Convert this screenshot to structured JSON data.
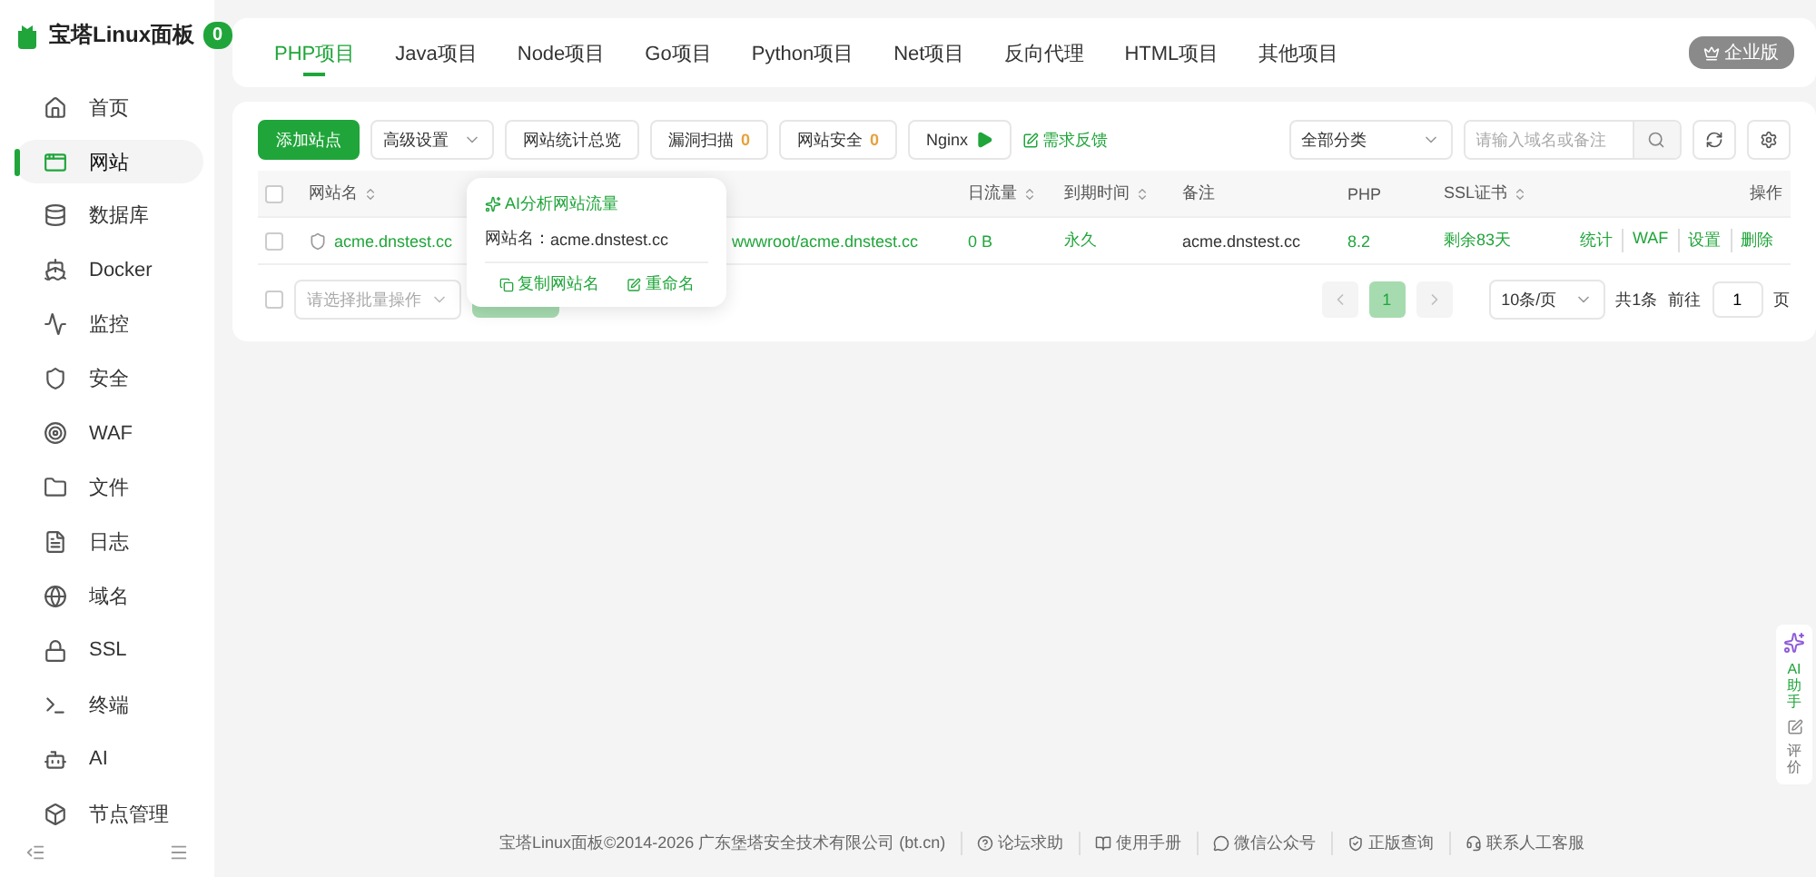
{
  "sidebar": {
    "brand": "宝塔Linux面板",
    "badge": "0",
    "items": [
      {
        "label": "首页",
        "selected": false
      },
      {
        "label": "网站",
        "selected": true
      },
      {
        "label": "数据库",
        "selected": false
      },
      {
        "label": "Docker",
        "selected": false
      },
      {
        "label": "监控",
        "selected": false
      },
      {
        "label": "安全",
        "selected": false
      },
      {
        "label": "WAF",
        "selected": false
      },
      {
        "label": "文件",
        "selected": false
      },
      {
        "label": "日志",
        "selected": false
      },
      {
        "label": "域名",
        "selected": false
      },
      {
        "label": "SSL",
        "selected": false
      },
      {
        "label": "终端",
        "selected": false
      },
      {
        "label": "AI",
        "selected": false
      },
      {
        "label": "节点管理",
        "selected": false
      }
    ]
  },
  "tabs": [
    {
      "label": "PHP项目",
      "selected": true
    },
    {
      "label": "Java项目",
      "selected": false
    },
    {
      "label": "Node项目",
      "selected": false
    },
    {
      "label": "Go项目",
      "selected": false
    },
    {
      "label": "Python项目",
      "selected": false
    },
    {
      "label": "Net项目",
      "selected": false
    },
    {
      "label": "反向代理",
      "selected": false
    },
    {
      "label": "HTML项目",
      "selected": false
    },
    {
      "label": "其他项目",
      "selected": false
    }
  ],
  "edition": "企业版",
  "toolbar": {
    "add": "添加站点",
    "advanced": "高级设置",
    "stats": "网站统计总览",
    "scan": {
      "label": "漏洞扫描",
      "count": "0"
    },
    "security": {
      "label": "网站安全",
      "count": "0"
    },
    "server": "Nginx",
    "feedback": "需求反馈",
    "category": "全部分类",
    "search": {
      "placeholder": "请输入域名或备注"
    }
  },
  "table": {
    "columns": [
      {
        "label": "网站名",
        "sort": true
      },
      {
        "label": "日流量",
        "sort": true
      },
      {
        "label": "到期时间",
        "sort": true
      },
      {
        "label": "备注",
        "sort": false
      },
      {
        "label": "PHP",
        "sort": false
      },
      {
        "label": "SSL证书",
        "sort": true
      },
      {
        "label": "操作",
        "sort": false
      }
    ],
    "select_all_checked": false,
    "rows": [
      {
        "checked": false,
        "name": "acme.dnstest.cc",
        "path": "wwwroot/acme.dnstest.cc",
        "traffic": "0 B",
        "expiry": "永久",
        "note": "acme.dnstest.cc",
        "php": "8.2",
        "ssl": "剩余83天",
        "actions": [
          "统计",
          "WAF",
          "设置",
          "删除"
        ]
      }
    ]
  },
  "batch": {
    "checked": false,
    "placeholder": "请选择批量操作"
  },
  "pagination": {
    "pages": [
      {
        "label": "1",
        "selected": true
      }
    ],
    "page_size": "10条/页",
    "total": "共1条",
    "goto": "前往",
    "goto_value": "1",
    "page_unit": "页"
  },
  "popover": {
    "ai": "AI分析网站流量",
    "site_label": "网站名：",
    "site": "acme.dnstest.cc",
    "copy": "复制网站名",
    "rename": "重命名"
  },
  "footer": {
    "copyright": "宝塔Linux面板©2014-2026 广东堡塔安全技术有限公司 (bt.cn)",
    "links": [
      "论坛求助",
      "使用手册",
      "微信公众号",
      "正版查询",
      "联系人工客服"
    ]
  },
  "assistant": {
    "ai": "AI助手",
    "rate": "评价"
  }
}
